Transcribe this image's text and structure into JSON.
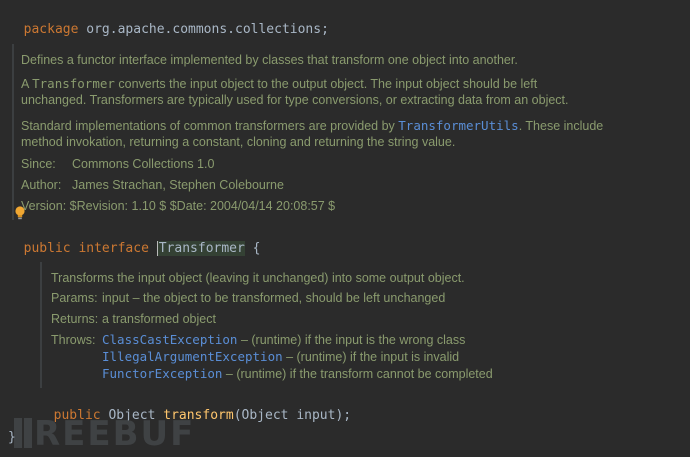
{
  "editor": {
    "package_line": {
      "keyword": "package",
      "name": "org.apache.commons.collections;"
    },
    "class_doc": {
      "description": "Defines a functor interface implemented by classes that transform one object into another.",
      "para2_pre": "A ",
      "para2_code": "Transformer",
      "para2_line1_rest": " converts the input object to the output object. The input object should be left",
      "para2_line2": "unchanged. Transformers are typically used for type conversions, or extracting data from an object.",
      "para3_line1_pre": "Standard implementations of common transformers are provided by ",
      "para3_link": "TransformerUtils",
      "para3_line1_post": ". These include",
      "para3_line2": "method invokation, returning a constant, cloning and returning the string value.",
      "since_label": "Since:",
      "since_value": "Commons Collections 1.0",
      "author_label": "Author:",
      "author_value": "James Strachan, Stephen Colebourne",
      "version_label": "Version:",
      "version_value": "$Revision: 1.10 $ $Date: 2004/04/14 20:08:57 $"
    },
    "interface_line": {
      "kw_public": "public",
      "kw_interface": "interface",
      "name": "Transformer",
      "brace": "{"
    },
    "method_doc": {
      "description": "Transforms the input object (leaving it unchanged) into some output object.",
      "params_label": "Params:",
      "params_value": "input – the object to be transformed, should be left unchanged",
      "returns_label": "Returns:",
      "returns_value": "a transformed object",
      "throws_label": "Throws:",
      "throws": [
        {
          "exception": "ClassCastException",
          "text": " – (runtime) if the input is the wrong class"
        },
        {
          "exception": "IllegalArgumentException",
          "text": " – (runtime) if the input is invalid"
        },
        {
          "exception": "FunctorException",
          "text": " – (runtime) if the transform cannot be completed"
        }
      ]
    },
    "method_line": {
      "kw_public": "public",
      "return_type": "Object",
      "name": "transform",
      "params": "(Object input);"
    },
    "closing_brace": "}"
  },
  "watermark": {
    "text": "REEBUF"
  },
  "colors": {
    "background": "#2b2b2b",
    "keyword": "#cc7832",
    "method": "#ffc66d",
    "doc_text": "#8a9b6e",
    "link": "#5a8ed6",
    "code_text": "#a9b7c6"
  }
}
